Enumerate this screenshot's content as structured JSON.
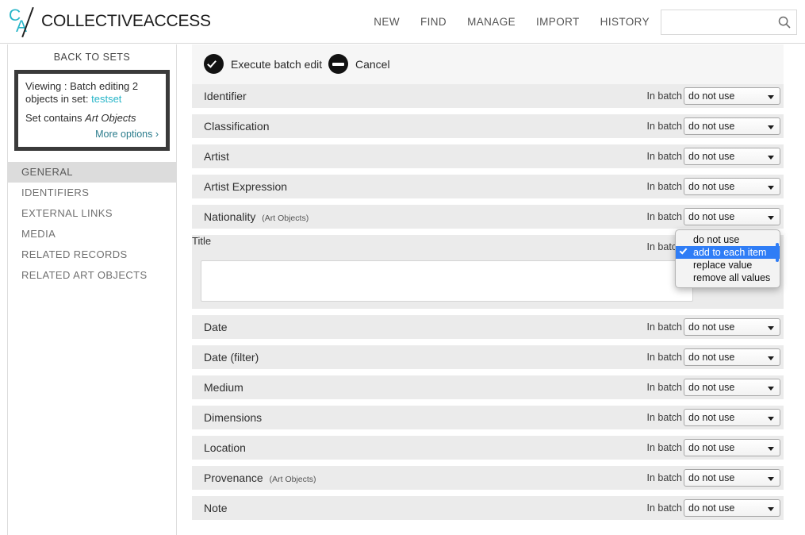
{
  "header": {
    "logo_c": "C",
    "logo_a": "A",
    "logo_text": "COLLECTIVEACCESS",
    "nav": [
      {
        "label": "NEW",
        "name": "nav-new"
      },
      {
        "label": "FIND",
        "name": "nav-find"
      },
      {
        "label": "MANAGE",
        "name": "nav-manage"
      },
      {
        "label": "IMPORT",
        "name": "nav-import"
      },
      {
        "label": "HISTORY",
        "name": "nav-history"
      }
    ],
    "search": {
      "value": "",
      "placeholder": "",
      "icon": "search-icon"
    }
  },
  "sidebar": {
    "back_to_sets": "BACK TO SETS",
    "set_info": {
      "viewing_prefix": "Viewing : Batch editing 2 objects in set:",
      "set_name": "testset",
      "contains_prefix": "Set contains",
      "contains_value": "Art Objects",
      "more_options": "More options ›"
    },
    "items": [
      {
        "label": "GENERAL",
        "selected": true
      },
      {
        "label": "IDENTIFIERS",
        "selected": false
      },
      {
        "label": "EXTERNAL LINKS",
        "selected": false
      },
      {
        "label": "MEDIA",
        "selected": false
      },
      {
        "label": "RELATED RECORDS",
        "selected": false
      },
      {
        "label": "RELATED ART OBJECTS",
        "selected": false
      }
    ]
  },
  "main": {
    "toolbar": {
      "execute_label": "Execute batch edit",
      "execute_icon": "check-circle-icon",
      "cancel_label": "Cancel",
      "cancel_icon": "minus-circle-icon"
    },
    "in_batch_label": "In batch",
    "default_select_value": "do not use",
    "rows": [
      {
        "label": "Identifier",
        "sublabel": "",
        "select_value": "do not use",
        "expanded": false
      },
      {
        "label": "Classification",
        "sublabel": "",
        "select_value": "do not use",
        "expanded": false
      },
      {
        "label": "Artist",
        "sublabel": "",
        "select_value": "do not use",
        "expanded": false
      },
      {
        "label": "Artist Expression",
        "sublabel": "",
        "select_value": "do not use",
        "expanded": false
      },
      {
        "label": "Nationality",
        "sublabel": "(Art Objects)",
        "select_value": "do not use",
        "expanded": false
      },
      {
        "label": "Title",
        "sublabel": "",
        "select_value": "add to each item",
        "expanded": true,
        "input_value": "",
        "input_placeholder": ""
      },
      {
        "label": "Date",
        "sublabel": "",
        "select_value": "do not use",
        "expanded": false
      },
      {
        "label": "Date (filter)",
        "sublabel": "",
        "select_value": "do not use",
        "expanded": false
      },
      {
        "label": "Medium",
        "sublabel": "",
        "select_value": "do not use",
        "expanded": false
      },
      {
        "label": "Dimensions",
        "sublabel": "",
        "select_value": "do not use",
        "expanded": false
      },
      {
        "label": "Location",
        "sublabel": "",
        "select_value": "do not use",
        "expanded": false
      },
      {
        "label": "Provenance",
        "sublabel": "(Art Objects)",
        "select_value": "do not use",
        "expanded": false
      },
      {
        "label": "Note",
        "sublabel": "",
        "select_value": "do not use",
        "expanded": false
      }
    ]
  },
  "dropdown": {
    "open_for_row": "Nationality",
    "options": [
      {
        "label": "do not use",
        "selected": false
      },
      {
        "label": "add to each item",
        "selected": true
      },
      {
        "label": "replace value",
        "selected": false
      },
      {
        "label": "remove all values",
        "selected": false
      }
    ]
  },
  "colors": {
    "brand_cyan": "#27b5c8",
    "link_teal": "#2b7c8c",
    "row_gray": "#ebebeb",
    "toolbar_gray": "#f6f6f6",
    "selected_blue": "#2f7df6",
    "sidebar_selected": "#dcdcdc",
    "icon_black": "#121212"
  }
}
